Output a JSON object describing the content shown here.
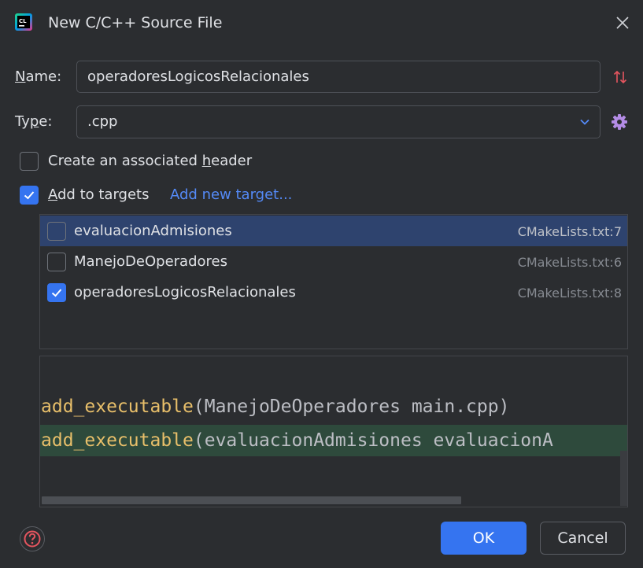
{
  "window": {
    "title": "New C/C++ Source File",
    "app_icon_text": "CL"
  },
  "form": {
    "name_label_accel": "N",
    "name_label_rest": "ame:",
    "name_value": "operadoresLogicosRelacionales",
    "type_label_pre": "Ty",
    "type_label_accel": "p",
    "type_label_post": "e:",
    "type_value": ".cpp",
    "header_label_pre": "Create an associated ",
    "header_label_accel": "h",
    "header_label_post": "eader",
    "header_checked": false,
    "targets_label_accel": "A",
    "targets_label_rest": "dd to targets",
    "targets_checked": true,
    "add_new_target_link": "Add new target..."
  },
  "targets": [
    {
      "name": "evaluacionAdmisiones",
      "file": "CMakeLists.txt:7",
      "checked": false,
      "selected": true
    },
    {
      "name": "ManejoDeOperadores",
      "file": "CMakeLists.txt:6",
      "checked": false,
      "selected": false
    },
    {
      "name": "operadoresLogicosRelacionales",
      "file": "CMakeLists.txt:8",
      "checked": true,
      "selected": false
    }
  ],
  "preview": {
    "lines": [
      {
        "fn": "add_executable",
        "args": "(ManejoDeOperadores main.cpp)",
        "highlighted": false
      },
      {
        "fn": "add_executable",
        "args": "(evaluacionAdmisiones evaluacionA",
        "highlighted": true
      }
    ]
  },
  "buttons": {
    "ok": "OK",
    "cancel": "Cancel"
  },
  "colors": {
    "background": "#2b2d30",
    "accent": "#3574f0",
    "link": "#548af7",
    "selection": "#2e436e",
    "code_function": "#e8bf6a",
    "code_highlight": "#2e4a3c",
    "help_icon": "#e5555f",
    "gear_icon": "#b48ce6"
  },
  "icons": {
    "app": "clion-logo-icon",
    "close": "close-icon",
    "sort": "sort-arrows-icon",
    "gear": "gear-icon",
    "chevron": "chevron-down-icon",
    "help": "help-icon",
    "check": "checkmark-icon"
  }
}
